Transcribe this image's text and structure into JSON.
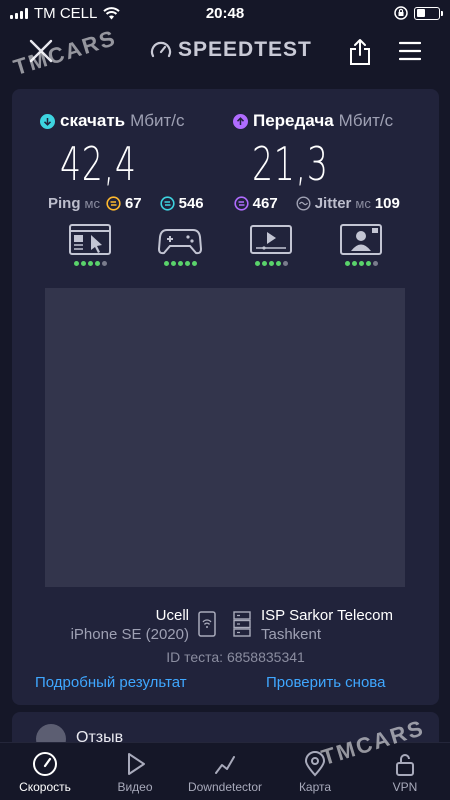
{
  "status_bar": {
    "carrier": "TM CELL",
    "time": "20:48"
  },
  "header": {
    "logo_text": "SPEEDTEST"
  },
  "download": {
    "label": "скачать",
    "unit": "Мбит/с",
    "value": "42,4"
  },
  "upload": {
    "label": "Передача",
    "unit": "Мбит/с",
    "value": "21,3"
  },
  "ping": {
    "label": "Ping",
    "unit": "мс",
    "idle": "67",
    "download": "546",
    "upload": "467",
    "jitter_label": "Jitter",
    "jitter_unit": "мс",
    "jitter": "109"
  },
  "quality": [
    {
      "icon": "browsing-icon",
      "rating": 4,
      "max": 5
    },
    {
      "icon": "gaming-icon",
      "rating": 5,
      "max": 5
    },
    {
      "icon": "video-streaming-icon",
      "rating": 4,
      "max": 5
    },
    {
      "icon": "video-call-icon",
      "rating": 4,
      "max": 5
    }
  ],
  "device": {
    "provider": "Ucell",
    "model": "iPhone SE (2020)"
  },
  "server": {
    "isp": "ISP Sarkor Telecom",
    "city": "Tashkent"
  },
  "test_id": "ID теста: 6858835341",
  "links": {
    "detailed": "Подробный результат",
    "retry": "Проверить снова"
  },
  "feedback": {
    "label": "Отзыв"
  },
  "nav": [
    {
      "label": "Скорость",
      "icon": "speed-icon",
      "active": true
    },
    {
      "label": "Видео",
      "icon": "play-icon",
      "active": false
    },
    {
      "label": "Downdetector",
      "icon": "downdetector-icon",
      "active": false
    },
    {
      "label": "Карта",
      "icon": "map-pin-icon",
      "active": false
    },
    {
      "label": "VPN",
      "icon": "lock-icon",
      "active": false
    }
  ],
  "watermark": "TMCARS",
  "colors": {
    "background": "#151728",
    "card": "#21233b",
    "download_accent": "#3ed4e0",
    "upload_accent": "#b06cff",
    "idle_ping": "#ffb92e",
    "link": "#3fa7ff",
    "rating_on": "#5ad36b"
  }
}
